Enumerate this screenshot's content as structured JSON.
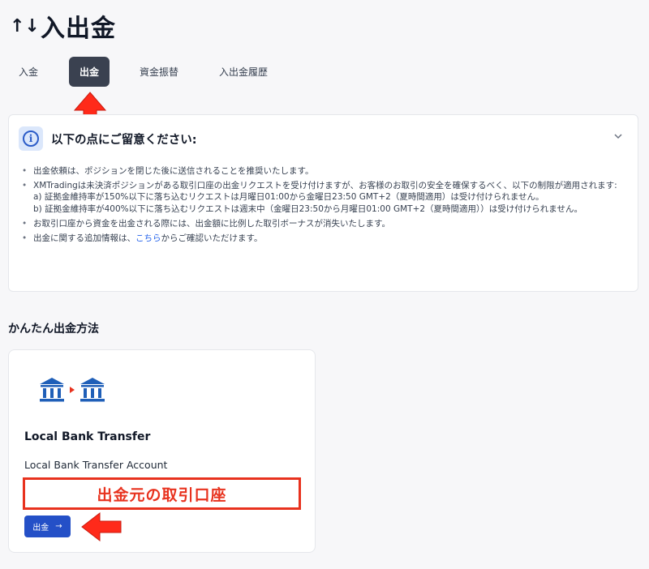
{
  "page": {
    "icon": "↑↓",
    "title": "入出金"
  },
  "tabs": [
    {
      "label": "入金",
      "active": false
    },
    {
      "label": "出金",
      "active": true
    },
    {
      "label": "資金振替",
      "active": false
    },
    {
      "label": "入出金履歴",
      "active": false
    }
  ],
  "notice": {
    "title": "以下の点にご留意ください:",
    "items": {
      "i1": "出金依頼は、ポジションを閉じた後に送信されることを推奨いたします。",
      "i2": "XMTradingは未決済ポジションがある取引口座の出金リクエストを受け付けますが、お客様のお取引の安全を確保するべく、以下の制限が適用されます:",
      "i2a": "a) 証拠金維持率が150%以下に落ち込むリクエストは月曜日01:00から金曜日23:50 GMT+2（夏時間適用）は受け付けられません。",
      "i2b": "b) 証拠金維持率が400%以下に落ち込むリクエストは週末中（金曜日23:50から月曜日01:00 GMT+2（夏時間適用））は受け付けられません。",
      "i3": "お取引口座から資金を出金される際には、出金額に比例した取引ボーナスが消失いたします。",
      "i4_pre": "出金に関する追加情報は、",
      "i4_link": "こちら",
      "i4_post": "からご確認いただけます。"
    }
  },
  "section": {
    "title": "かんたん出金方法"
  },
  "card": {
    "title": "Local Bank Transfer",
    "subtitle": "Local Bank Transfer Account",
    "annotation": "出金元の取引口座",
    "button_label": "出金",
    "button_arrow": "→"
  },
  "colors": {
    "active_tab": "#3a4150",
    "primary_button": "#2450c7",
    "annotation_red": "#e8321e",
    "bank_icon_blue": "#1f5fb8",
    "link": "#2563eb"
  },
  "icons": [
    "arrows-up-down-icon",
    "info-icon",
    "chevron-down-icon",
    "bank-icon",
    "arrow-right-icon"
  ]
}
